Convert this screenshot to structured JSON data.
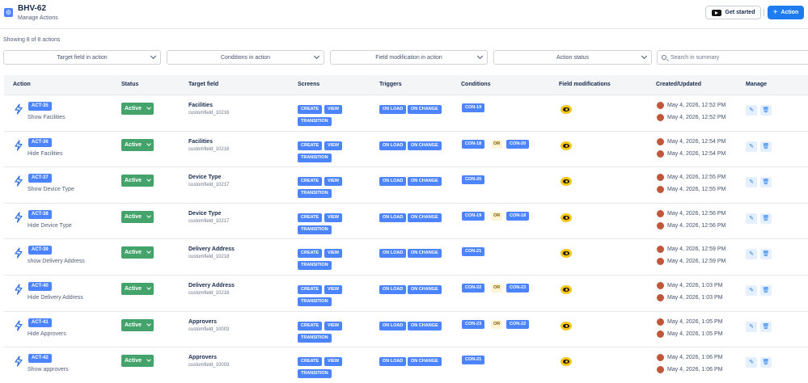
{
  "header": {
    "title": "BHV-62",
    "subtitle": "Manage Actions",
    "get_started_label": "Get started",
    "action_button_label": "Action"
  },
  "summary": {
    "showing": "Showing 8 of 8 actions"
  },
  "filters": {
    "target_field": "Target field in action",
    "conditions": "Conditions in action",
    "field_modification": "Field modification in action",
    "action_status": "Action status",
    "search_placeholder": "Search in summary"
  },
  "columns": {
    "action": "Action",
    "status": "Status",
    "target_field": "Target field",
    "screens": "Screens",
    "triggers": "Triggers",
    "conditions": "Conditions",
    "field_modifications": "Field modifications",
    "created_updated": "Created/Updated",
    "manage": "Manage"
  },
  "labels": {
    "status_active": "Active",
    "screen_create": "CREATE",
    "screen_view": "VIEW",
    "screen_transition": "TRANSITION",
    "trigger_on_load": "ON LOAD",
    "trigger_on_change": "ON CHANGE",
    "or": "OR"
  },
  "rows": [
    {
      "id": "ACT-35",
      "name": "Show Facilities",
      "field": "Facilities",
      "field_id": "customfield_10216",
      "conditions": [
        "CON-19"
      ],
      "created": "May 4, 2026, 12:52 PM",
      "updated": "May 4, 2026, 12:52 PM"
    },
    {
      "id": "ACT-36",
      "name": "Hide Facilities",
      "field": "Facilities",
      "field_id": "customfield_10216",
      "conditions": [
        "CON-18",
        "CON-20"
      ],
      "created": "May 4, 2026, 12:54 PM",
      "updated": "May 4, 2026, 12:54 PM"
    },
    {
      "id": "ACT-37",
      "name": "Show Device Type",
      "field": "Device Type",
      "field_id": "customfield_10217",
      "conditions": [
        "CON-20"
      ],
      "created": "May 4, 2026, 12:55 PM",
      "updated": "May 4, 2026, 12:55 PM"
    },
    {
      "id": "ACT-38",
      "name": "Hide Device Type",
      "field": "Device Type",
      "field_id": "customfield_10217",
      "conditions": [
        "CON-19",
        "CON-18"
      ],
      "created": "May 4, 2026, 12:56 PM",
      "updated": "May 4, 2026, 12:56 PM"
    },
    {
      "id": "ACT-39",
      "name": "show Delivery Address",
      "field": "Delivery Address",
      "field_id": "customfield_10218",
      "conditions": [
        "CON-21"
      ],
      "created": "May 4, 2026, 12:59 PM",
      "updated": "May 4, 2026, 12:59 PM"
    },
    {
      "id": "ACT-40",
      "name": "Hide Delivery Address",
      "field": "Delivery Address",
      "field_id": "customfield_10218",
      "conditions": [
        "CON-22",
        "CON-23"
      ],
      "created": "May 4, 2026, 1:03 PM",
      "updated": "May 4, 2026, 1:03 PM"
    },
    {
      "id": "ACT-41",
      "name": "Hide Approvers",
      "field": "Approvers",
      "field_id": "customfield_10003",
      "conditions": [
        "CON-23",
        "CON-22"
      ],
      "created": "May 4, 2026, 1:05 PM",
      "updated": "May 4, 2026, 1:05 PM"
    },
    {
      "id": "ACT-42",
      "name": "Show approvers",
      "field": "Approvers",
      "field_id": "customfield_10003",
      "conditions": [
        "CON-21"
      ],
      "created": "May 4, 2026, 1:06 PM",
      "updated": "May 4, 2026, 1:06 PM"
    }
  ],
  "icons": {
    "app": "settings-icon",
    "action": "lightning-bolt-icon",
    "field_modification": "eye-icon",
    "edit": "edit-icon",
    "delete": "trash-icon",
    "search": "search-icon",
    "youtube": "youtube-icon"
  },
  "colors": {
    "accent": "#1f7cf0",
    "tag": "#4c84ff",
    "active": "#43a36a",
    "eye": "#f5c518"
  }
}
